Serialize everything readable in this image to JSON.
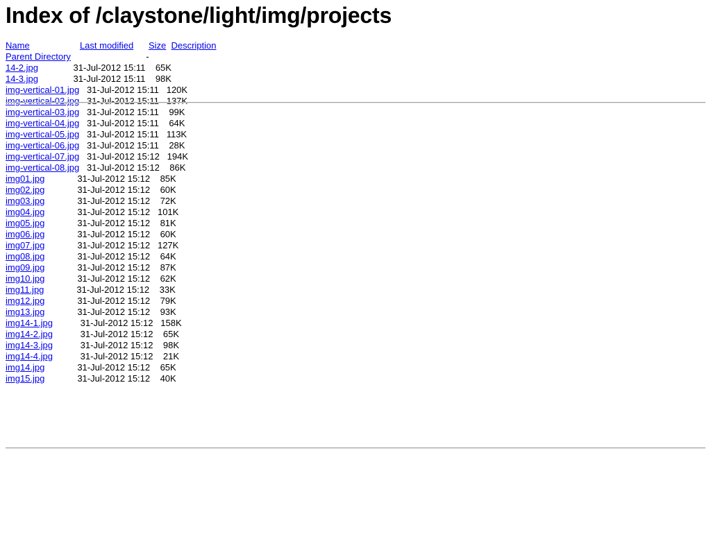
{
  "page": {
    "title": "Index of /claystone/light/img/projects",
    "path": "/claystone/light/img/projects",
    "link_color": "#0000EE",
    "text_color": "#000000",
    "background_color": "#FFFFFF",
    "rule_color": "#A0A0A0"
  },
  "columns": {
    "name": "Name",
    "last_modified": "Last modified",
    "size": "Size",
    "description": "Description"
  },
  "parent": {
    "label": "Parent Directory",
    "last_modified": "",
    "size": "-",
    "description": ""
  },
  "entries": [
    {
      "name": "14-2.jpg",
      "last_modified": "31-Jul-2012 15:11",
      "size": "65K",
      "description": ""
    },
    {
      "name": "14-3.jpg",
      "last_modified": "31-Jul-2012 15:11",
      "size": "98K",
      "description": ""
    },
    {
      "name": "img-vertical-01.jpg",
      "last_modified": "31-Jul-2012 15:11",
      "size": "120K",
      "description": ""
    },
    {
      "name": "img-vertical-02.jpg",
      "last_modified": "31-Jul-2012 15:11",
      "size": "137K",
      "description": ""
    },
    {
      "name": "img-vertical-03.jpg",
      "last_modified": "31-Jul-2012 15:11",
      "size": "99K",
      "description": ""
    },
    {
      "name": "img-vertical-04.jpg",
      "last_modified": "31-Jul-2012 15:11",
      "size": "64K",
      "description": ""
    },
    {
      "name": "img-vertical-05.jpg",
      "last_modified": "31-Jul-2012 15:11",
      "size": "113K",
      "description": ""
    },
    {
      "name": "img-vertical-06.jpg",
      "last_modified": "31-Jul-2012 15:11",
      "size": "28K",
      "description": ""
    },
    {
      "name": "img-vertical-07.jpg",
      "last_modified": "31-Jul-2012 15:12",
      "size": "194K",
      "description": ""
    },
    {
      "name": "img-vertical-08.jpg",
      "last_modified": "31-Jul-2012 15:12",
      "size": "86K",
      "description": ""
    },
    {
      "name": "img01.jpg",
      "last_modified": "31-Jul-2012 15:12",
      "size": "85K",
      "description": ""
    },
    {
      "name": "img02.jpg",
      "last_modified": "31-Jul-2012 15:12",
      "size": "60K",
      "description": ""
    },
    {
      "name": "img03.jpg",
      "last_modified": "31-Jul-2012 15:12",
      "size": "72K",
      "description": ""
    },
    {
      "name": "img04.jpg",
      "last_modified": "31-Jul-2012 15:12",
      "size": "101K",
      "description": ""
    },
    {
      "name": "img05.jpg",
      "last_modified": "31-Jul-2012 15:12",
      "size": "81K",
      "description": ""
    },
    {
      "name": "img06.jpg",
      "last_modified": "31-Jul-2012 15:12",
      "size": "60K",
      "description": ""
    },
    {
      "name": "img07.jpg",
      "last_modified": "31-Jul-2012 15:12",
      "size": "127K",
      "description": ""
    },
    {
      "name": "img08.jpg",
      "last_modified": "31-Jul-2012 15:12",
      "size": "64K",
      "description": ""
    },
    {
      "name": "img09.jpg",
      "last_modified": "31-Jul-2012 15:12",
      "size": "87K",
      "description": ""
    },
    {
      "name": "img10.jpg",
      "last_modified": "31-Jul-2012 15:12",
      "size": "62K",
      "description": ""
    },
    {
      "name": "img11.jpg",
      "last_modified": "31-Jul-2012 15:12",
      "size": "33K",
      "description": ""
    },
    {
      "name": "img12.jpg",
      "last_modified": "31-Jul-2012 15:12",
      "size": "79K",
      "description": ""
    },
    {
      "name": "img13.jpg",
      "last_modified": "31-Jul-2012 15:12",
      "size": "93K",
      "description": ""
    },
    {
      "name": "img14-1.jpg",
      "last_modified": "31-Jul-2012 15:12",
      "size": "158K",
      "description": ""
    },
    {
      "name": "img14-2.jpg",
      "last_modified": "31-Jul-2012 15:12",
      "size": "65K",
      "description": ""
    },
    {
      "name": "img14-3.jpg",
      "last_modified": "31-Jul-2012 15:12",
      "size": "98K",
      "description": ""
    },
    {
      "name": "img14-4.jpg",
      "last_modified": "31-Jul-2012 15:12",
      "size": "21K",
      "description": ""
    },
    {
      "name": "img14.jpg",
      "last_modified": "31-Jul-2012 15:12",
      "size": "65K",
      "description": ""
    },
    {
      "name": "img15.jpg",
      "last_modified": "31-Jul-2012 15:12",
      "size": "40K",
      "description": ""
    }
  ]
}
